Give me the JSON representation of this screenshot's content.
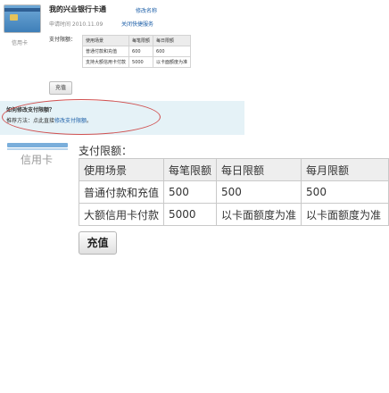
{
  "top": {
    "card_title": "我的兴业银行卡通",
    "edit_name_link": "修改名称",
    "apply_time": "申请时间 2010.11.09",
    "close_quick_pay": "关闭快捷服务",
    "card_label": "信用卡",
    "limit_label": "支付限额：",
    "table": {
      "headers": [
        "使用场景",
        "每笔限额",
        "每日限额"
      ],
      "rows": [
        [
          "普通付款和充值",
          "600",
          "600"
        ],
        [
          "支持大额信用卡付款",
          "5000",
          "以卡面额度为准"
        ]
      ]
    },
    "recharge_button": "充值"
  },
  "help": {
    "question": "如何修改支付限额？",
    "answer_prefix": "推荐方法：点此直接",
    "answer_link": "修改支付限额",
    "answer_suffix": "。"
  },
  "main": {
    "card_label": "信用卡",
    "limit_label": "支付限额：",
    "table": {
      "headers": [
        "使用场景",
        "每笔限额",
        "每日限额",
        "每月限额"
      ],
      "rows": [
        [
          "普通付款和充值",
          "500",
          "500",
          "500"
        ],
        [
          "大额信用卡付款",
          "5000",
          "以卡面额度为准",
          "以卡面额度为准"
        ]
      ]
    },
    "recharge_button": "充值"
  }
}
